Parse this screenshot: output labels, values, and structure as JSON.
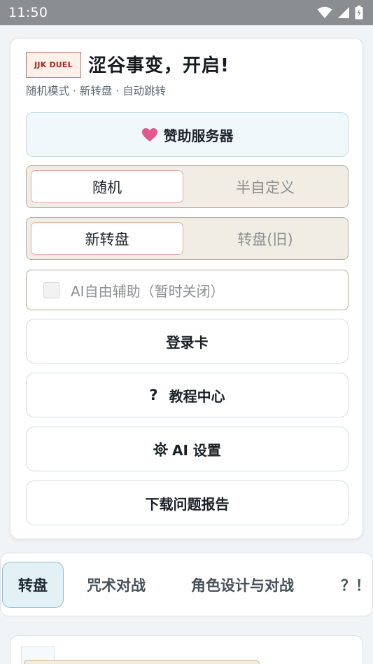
{
  "status_bar": {
    "time": "11:50"
  },
  "header": {
    "logo_text": "JJK DUEL",
    "title": "涩谷事变，开启!",
    "subtitle": "随机模式 · 新转盘 · 自动跳转"
  },
  "sponsor": {
    "label": "赞助服务器",
    "icon": "heart-icon",
    "icon_color": "#e05a8a"
  },
  "mode_toggle": {
    "options": [
      "随机",
      "半自定义"
    ],
    "selected": "随机"
  },
  "wheel_toggle": {
    "options": [
      "新转盘",
      "转盘(旧)"
    ],
    "selected": "新转盘"
  },
  "ai_assist": {
    "label": "AI自由辅助（暂时关闭）",
    "checked": false,
    "disabled": true
  },
  "buttons": {
    "login": "登录卡",
    "tutorial_icon": "?",
    "tutorial": "教程中心",
    "ai_settings": "AI 设置",
    "report": "下载问题报告"
  },
  "tabs": [
    {
      "label": "转盘",
      "active": true
    },
    {
      "label": "咒术对战",
      "active": false
    },
    {
      "label": "角色设计与对战",
      "active": false
    },
    {
      "label": "？！",
      "active": false
    }
  ]
}
